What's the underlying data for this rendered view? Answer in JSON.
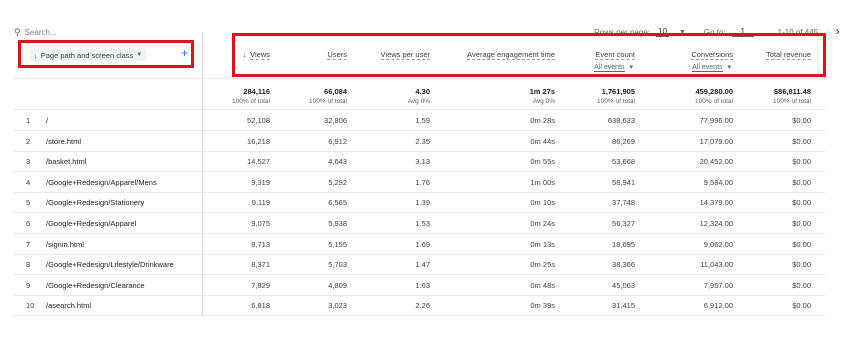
{
  "search": {
    "placeholder": "Search..."
  },
  "pager": {
    "rows_label": "Rows per page:",
    "rows_value": "10",
    "goto_label": "Go to:",
    "goto_value": "1",
    "range": "1-10 of 445"
  },
  "dimension": {
    "label": "Page path and screen class"
  },
  "columns": [
    {
      "label": "Views",
      "sort": "↓",
      "sub": "",
      "total": "284,116",
      "total_label": "100% of total"
    },
    {
      "label": "Users",
      "sub": "",
      "total": "66,084",
      "total_label": "100% of total"
    },
    {
      "label": "Views per user",
      "sub": "",
      "total": "4.30",
      "total_label": "Avg 0%"
    },
    {
      "label": "Average engagement time",
      "sub": "",
      "total": "1m 27s",
      "total_label": "Avg 0%"
    },
    {
      "label": "Event count",
      "sub": "All events",
      "total": "1,761,905",
      "total_label": "100% of total"
    },
    {
      "label": "Conversions",
      "sub": "All events",
      "total": "459,280.00",
      "total_label": "100% of total"
    },
    {
      "label": "Total revenue",
      "sub": "",
      "total": "$86,811.48",
      "total_label": "100% of total"
    }
  ],
  "rows": [
    {
      "n": "1",
      "path": "/",
      "v": [
        "52,108",
        "32,806",
        "1.59",
        "0m 28s",
        "638,633",
        "77,996.00",
        "$0.00"
      ]
    },
    {
      "n": "2",
      "path": "/store.html",
      "v": [
        "16,218",
        "6,912",
        "2.35",
        "0m 44s",
        "86,269",
        "17,079.00",
        "$0.00"
      ]
    },
    {
      "n": "3",
      "path": "/basket.html",
      "v": [
        "14,527",
        "4,643",
        "3.13",
        "0m 55s",
        "53,668",
        "20,452.00",
        "$0.00"
      ]
    },
    {
      "n": "4",
      "path": "/Google+Redesign/Apparel/Mens",
      "v": [
        "9,319",
        "5,292",
        "1.76",
        "1m 00s",
        "58,941",
        "9,584.00",
        "$0.00"
      ]
    },
    {
      "n": "5",
      "path": "/Google+Redesign/Stationery",
      "v": [
        "9,119",
        "6,565",
        "1.39",
        "0m 10s",
        "37,748",
        "14,379.00",
        "$0.00"
      ]
    },
    {
      "n": "6",
      "path": "/Google+Redesign/Apparel",
      "v": [
        "9,075",
        "5,938",
        "1.53",
        "0m 24s",
        "56,327",
        "12,324.00",
        "$0.00"
      ]
    },
    {
      "n": "7",
      "path": "/signin.html",
      "v": [
        "8,713",
        "5,155",
        "1.69",
        "0m 13s",
        "18,695",
        "9,062.00",
        "$0.00"
      ]
    },
    {
      "n": "8",
      "path": "/Google+Redesign/Lifestyle/Drinkware",
      "v": [
        "8,371",
        "5,703",
        "1.47",
        "0m 25s",
        "38,366",
        "11,043.00",
        "$0.00"
      ]
    },
    {
      "n": "9",
      "path": "/Google+Redesign/Clearance",
      "v": [
        "7,829",
        "4,809",
        "1.63",
        "0m 48s",
        "45,063",
        "7,957.00",
        "$0.00"
      ]
    },
    {
      "n": "10",
      "path": "/asearch.html",
      "v": [
        "6,818",
        "3,023",
        "2.26",
        "0m 39s",
        "31,415",
        "6,912.00",
        "$0.00"
      ]
    }
  ]
}
